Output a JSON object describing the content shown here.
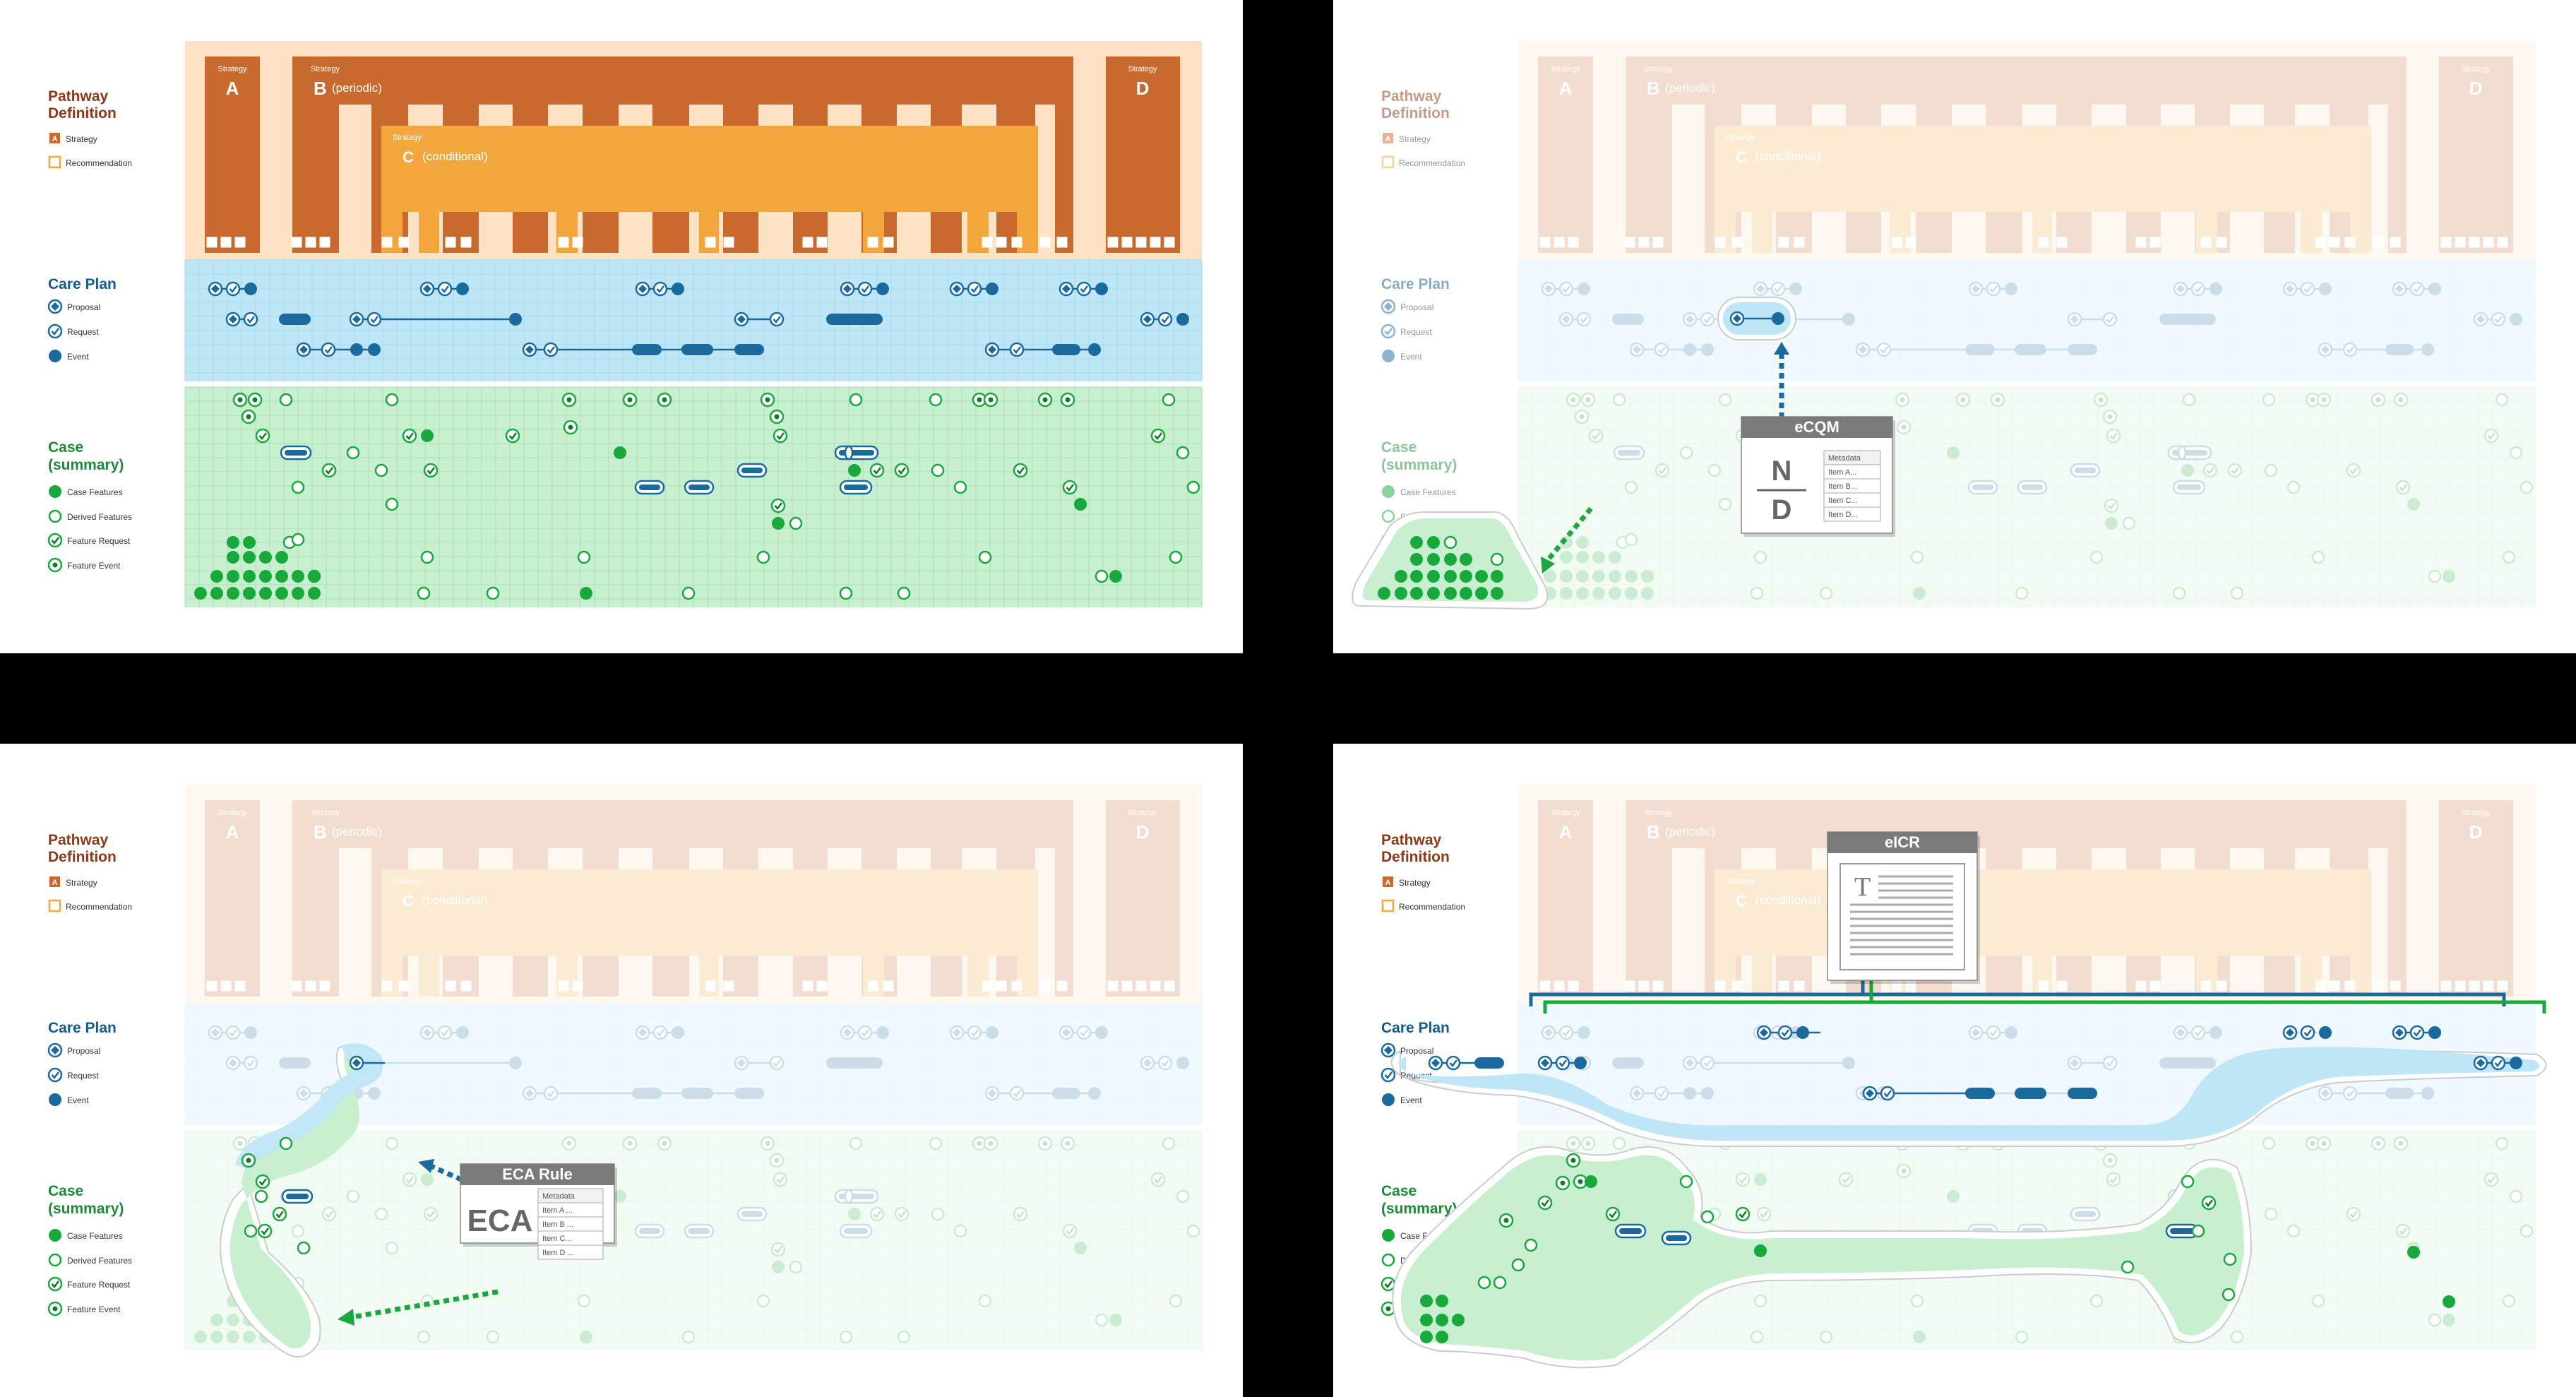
{
  "legend": {
    "pathway_title": "Pathway Definition",
    "pathway_title_lines": [
      "Pathway",
      "Definition"
    ],
    "strategy": "Strategy",
    "strategy_badge": "A",
    "recommendation": "Recommendation",
    "careplan_title": "Care Plan",
    "proposal": "Proposal",
    "request": "Request",
    "event": "Event",
    "case_title": "Case (summary)",
    "case_title_lines": [
      "Case",
      "(summary)"
    ],
    "case_features": "Case Features",
    "derived_features": "Derived Features",
    "feature_request": "Feature Request",
    "feature_event": "Feature Event"
  },
  "pathway": {
    "strategy_label": "Strategy",
    "strategy_a": "A",
    "strategy_b": "B",
    "strategy_b_note": "(periodic)",
    "strategy_c": "C",
    "strategy_c_note": "(conditional)",
    "strategy_d": "D"
  },
  "popups": {
    "ecqm": {
      "title": "eCQM",
      "numerator": "N",
      "denominator": "D",
      "meta": [
        "Metadata",
        "Item A...",
        "Item B...",
        "Item C...",
        "Item D..."
      ]
    },
    "eca": {
      "title": "ECA Rule",
      "big": "ECA",
      "meta": [
        "Metadata",
        "Item A ...",
        "Item B ...",
        "Item C...",
        "Item D ..."
      ]
    },
    "eicr": {
      "title": "eICR",
      "glyph": "T"
    }
  },
  "colors": {
    "pathway_bg": "#fde3c3",
    "strategy": "#c8692d",
    "recommendation": "#f2a63c",
    "careplan_bg": "#bfe6f7",
    "careplan": "#1a6a9e",
    "case_bg": "#c8efcf",
    "case": "#18a83c",
    "popup_header": "#7a7a7a"
  }
}
